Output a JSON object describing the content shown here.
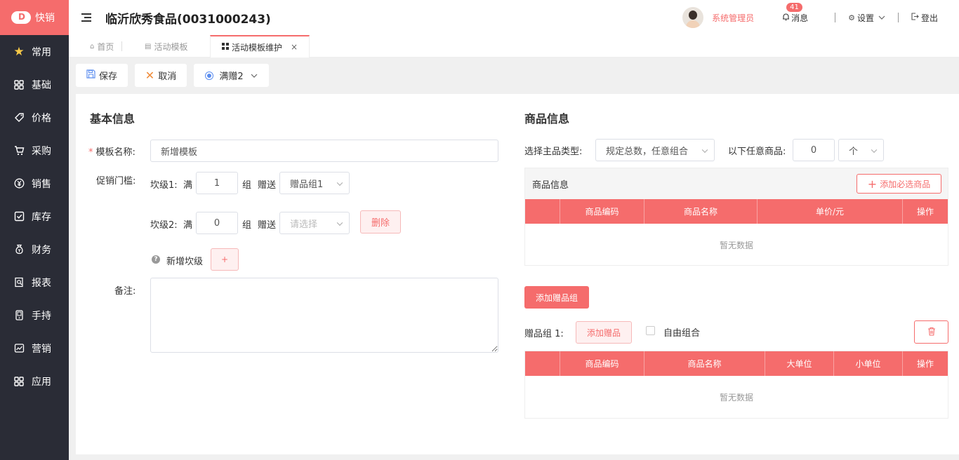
{
  "app": {
    "name": "快销"
  },
  "sidebar": {
    "items": [
      {
        "label": "常用",
        "icon": "star-icon"
      },
      {
        "label": "基础",
        "icon": "grid-icon"
      },
      {
        "label": "价格",
        "icon": "tag-icon"
      },
      {
        "label": "采购",
        "icon": "cart-icon"
      },
      {
        "label": "销售",
        "icon": "yen-icon"
      },
      {
        "label": "库存",
        "icon": "checkbox-icon"
      },
      {
        "label": "财务",
        "icon": "moneybag-icon"
      },
      {
        "label": "报表",
        "icon": "report-icon"
      },
      {
        "label": "手持",
        "icon": "handheld-icon"
      },
      {
        "label": "营销",
        "icon": "marketing-icon"
      },
      {
        "label": "应用",
        "icon": "apps-icon"
      }
    ]
  },
  "header": {
    "company": "临沂欣秀食品(0031000243)",
    "username": "系统管理员",
    "messages_label": "消息",
    "messages_count": "41",
    "settings_label": "设置",
    "logout_label": "登出"
  },
  "tabs": [
    {
      "label": "首页"
    },
    {
      "label": "活动模板"
    },
    {
      "label": "活动模板维护"
    }
  ],
  "toolbar": {
    "save_label": "保存",
    "cancel_label": "取消",
    "mode_label": "满赠2"
  },
  "basic": {
    "title": "基本信息",
    "template_name_label": "模板名称:",
    "template_name_value": "新增模板",
    "threshold_label": "促销门槛:",
    "tier1_label": "坎级1:",
    "tier2_label": "坎级2:",
    "full_label": "满",
    "group_label": "组",
    "gift_label": "赠送",
    "tier1_qty": "1",
    "tier1_gift": "赠品组1",
    "tier2_qty": "0",
    "tier2_gift_placeholder": "请选择",
    "delete_label": "删除",
    "add_tier_label": "新增坎级",
    "add_symbol": "+",
    "remark_label": "备注:"
  },
  "goods": {
    "title": "商品信息",
    "main_type_label": "选择主品类型:",
    "main_type_value": "规定总数，任意组合",
    "any_goods_label": "以下任意商品:",
    "any_goods_qty": "0",
    "unit_value": "个",
    "table1": {
      "caption": "商品信息",
      "add_button": "添加必选商品",
      "columns": [
        "",
        "商品编码",
        "商品名称",
        "单价/元",
        "操作"
      ],
      "empty_text": "暂无数据"
    },
    "add_gift_group_label": "添加赠品组",
    "gift_group_label": "赠品组 1:",
    "add_gift_label": "添加赠品",
    "free_combo_label": "自由组合",
    "table2": {
      "columns": [
        "",
        "商品编码",
        "商品名称",
        "大单位",
        "小单位",
        "操作"
      ],
      "empty_text": "暂无数据"
    }
  }
}
